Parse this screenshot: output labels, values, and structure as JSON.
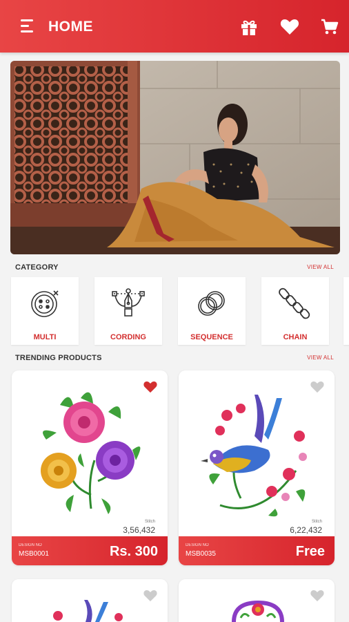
{
  "appbar": {
    "title": "HOME",
    "actions": [
      {
        "icon": "gift-icon"
      },
      {
        "icon": "heart-icon"
      },
      {
        "icon": "cart-icon"
      }
    ]
  },
  "category": {
    "heading": "CATEGORY",
    "view_all": "VIEW ALL",
    "items": [
      {
        "label": "MULTI",
        "icon": "button-icon"
      },
      {
        "label": "CORDING",
        "icon": "pen-tool-icon"
      },
      {
        "label": "SEQUENCE",
        "icon": "sequin-icon"
      },
      {
        "label": "CHAIN",
        "icon": "chain-icon"
      }
    ]
  },
  "trending": {
    "heading": "TRENDING PRODUCTS",
    "view_all": "VIEW ALL",
    "products": [
      {
        "stitch_label": "Stitch",
        "stitch": "3,56,432",
        "design_label": "DESIGN NO",
        "design_no": "MSB0001",
        "price": "Rs. 300",
        "favorite": true
      },
      {
        "stitch_label": "Stitch",
        "stitch": "6,22,432",
        "design_label": "DESIGN NO",
        "design_no": "MSB0035",
        "price": "Free",
        "favorite": false
      },
      {
        "favorite": false
      },
      {
        "favorite": false
      }
    ]
  },
  "colors": {
    "primary": "#d6242c",
    "heart_active": "#d32f2f",
    "heart_inactive": "#cccccc"
  }
}
